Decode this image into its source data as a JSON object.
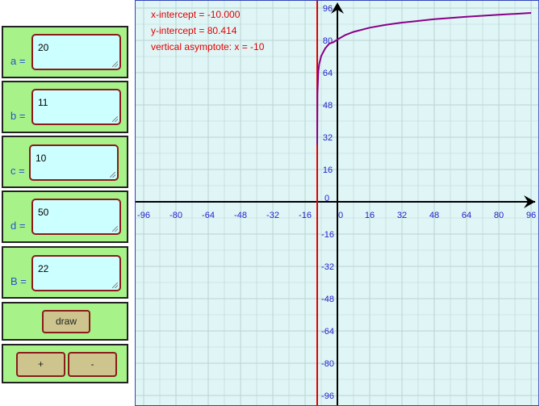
{
  "params": [
    {
      "label": "a =",
      "value": "20"
    },
    {
      "label": "b =",
      "value": "11"
    },
    {
      "label": "c =",
      "value": "10"
    },
    {
      "label": "d =",
      "value": "50"
    },
    {
      "label": "B =",
      "value": "22"
    }
  ],
  "buttons": {
    "draw": "draw",
    "plus": "+",
    "minus": "-"
  },
  "info": {
    "x_intercept": "x-intercept = -10.000",
    "y_intercept": "y-intercept = 80.414",
    "asymptote": "vertical asymptote: x = -10"
  },
  "colors": {
    "panel": "#a8f28a",
    "input_bg": "#ccffff",
    "button": "#cec58e",
    "curve": "#880088",
    "asymptote": "#e00000",
    "grid_bg": "#e0f6f6",
    "tick_labels": "#2222cc"
  },
  "chart_data": {
    "type": "line",
    "x_ticks": [
      "-96",
      "-80",
      "-64",
      "-48",
      "-32",
      "-16",
      "0",
      "16",
      "32",
      "48",
      "64",
      "80",
      "96"
    ],
    "y_ticks": [
      "96",
      "80",
      "64",
      "48",
      "32",
      "16",
      "0",
      "-16",
      "-32",
      "-48",
      "-64",
      "-80",
      "-96"
    ],
    "xlim": [
      -100,
      96
    ],
    "ylim": [
      -100,
      96
    ],
    "asymptote_x": -10,
    "series": [
      {
        "x": [
          -9.99,
          -9.9,
          -9.5,
          -9,
          -8,
          -6,
          -4,
          -2,
          0,
          4,
          8,
          16,
          24,
          32,
          48,
          64,
          80,
          96
        ],
        "y": [
          28.3,
          53.7,
          64.5,
          68.4,
          72.3,
          76.1,
          78.4,
          79.1,
          80.4,
          82.7,
          84.2,
          86.3,
          87.7,
          88.8,
          90.5,
          91.7,
          92.7,
          93.6
        ]
      }
    ]
  }
}
